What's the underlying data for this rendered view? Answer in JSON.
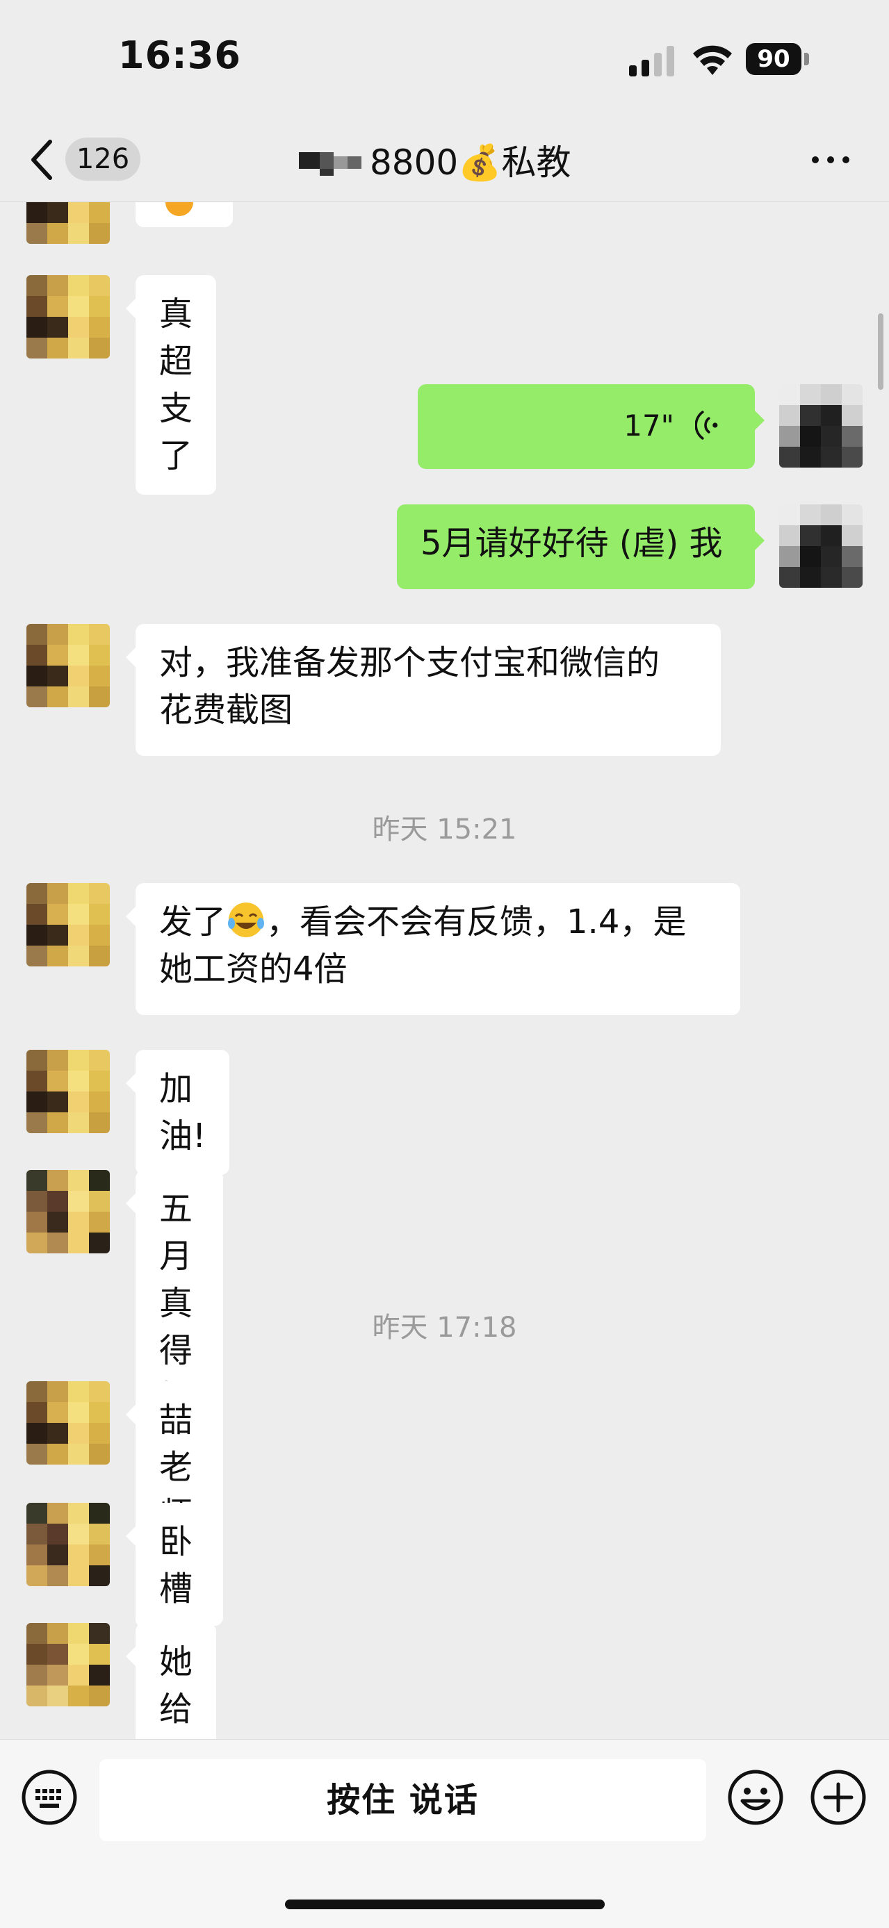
{
  "status_bar": {
    "time": "16:36",
    "battery": "90",
    "icons": [
      "signal-icon",
      "wifi-icon",
      "battery-icon"
    ]
  },
  "nav": {
    "unread_count": "126",
    "title": "8800💰私教",
    "back_icon": "chevron-left-icon",
    "more_icon": "more-icon"
  },
  "messages": [
    {
      "side": "in",
      "text": "真超支了"
    },
    {
      "side": "out",
      "type": "voice",
      "duration": "17\""
    },
    {
      "side": "out",
      "text": "5月请好好待 (虐) 我"
    },
    {
      "side": "in",
      "line1": "对，我准备发那个支付宝和微信的",
      "line2": "花费截图"
    },
    {
      "timestamp": "昨天 15:21"
    },
    {
      "side": "in",
      "line1_a": "发了",
      "line1_b": "，看会不会有反馈，1.4，是",
      "line2": "她工资的4倍"
    },
    {
      "side": "in",
      "text": "加油!"
    },
    {
      "side": "in",
      "text": "五月真得好好待我"
    },
    {
      "timestamp": "昨天 17:18"
    },
    {
      "side": "in",
      "text": "喆老师"
    },
    {
      "side": "in",
      "text": "卧槽"
    },
    {
      "side": "in",
      "text": "她给我发信息了"
    }
  ],
  "input": {
    "voice_button": "按住 说话",
    "icons": [
      "keyboard-icon",
      "emoji-icon",
      "plus-icon"
    ]
  },
  "colors": {
    "background": "#ededed",
    "outgoing_bubble": "#95ec69",
    "incoming_bubble": "#ffffff"
  }
}
